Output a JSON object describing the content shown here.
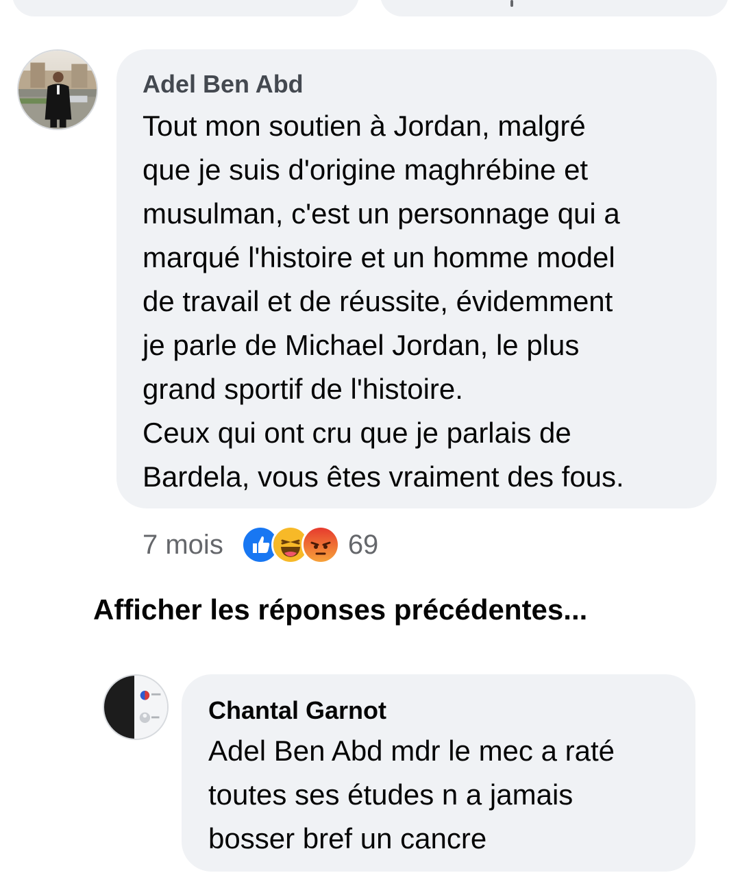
{
  "comments": [
    {
      "author": "Adel Ben Abd",
      "text_lines": [
        "Tout mon soutien à Jordan, malgré",
        "que je suis d'origine maghrébine et",
        "musulman, c'est un personnage qui a",
        "marqué l'histoire et un homme model",
        "de travail et de réussite, évidemment",
        "je parle de Michael Jordan, le plus",
        "grand sportif de l'histoire.",
        "Ceux qui ont cru que je parlais de",
        "Bardela, vous êtes vraiment des fous."
      ],
      "time": "7 mois",
      "reactions": [
        "like-icon",
        "haha-icon",
        "angry-icon"
      ],
      "reaction_count": "69"
    },
    {
      "author": "Chantal Garnot",
      "text_lines": [
        "Adel Ben Abd mdr le mec a raté",
        "toutes ses études n a jamais",
        "bosser bref un cancre"
      ]
    }
  ],
  "view_previous_replies": "Afficher les réponses précédentes...",
  "colors": {
    "bubble": "#f0f2f5",
    "text": "#050505",
    "meta": "#65676b",
    "like": "#1877f2",
    "haha": "#f7b928",
    "angry": "#e9710f"
  }
}
